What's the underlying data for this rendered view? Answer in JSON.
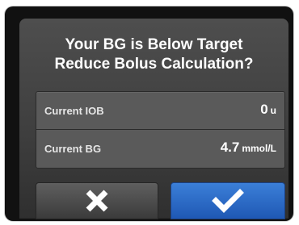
{
  "dialog": {
    "title_line1": "Your BG is Below Target",
    "title_line2": "Reduce Bolus Calculation?"
  },
  "rows": [
    {
      "label": "Current IOB",
      "value": "0",
      "unit": "u"
    },
    {
      "label": "Current BG",
      "value": "4.7",
      "unit": "mmol/L"
    }
  ],
  "buttons": {
    "cancel_icon": "close-x-icon",
    "confirm_icon": "checkmark-icon"
  },
  "colors": {
    "confirm_button": "#2a6ac6",
    "cancel_button": "#4a4a4a"
  }
}
